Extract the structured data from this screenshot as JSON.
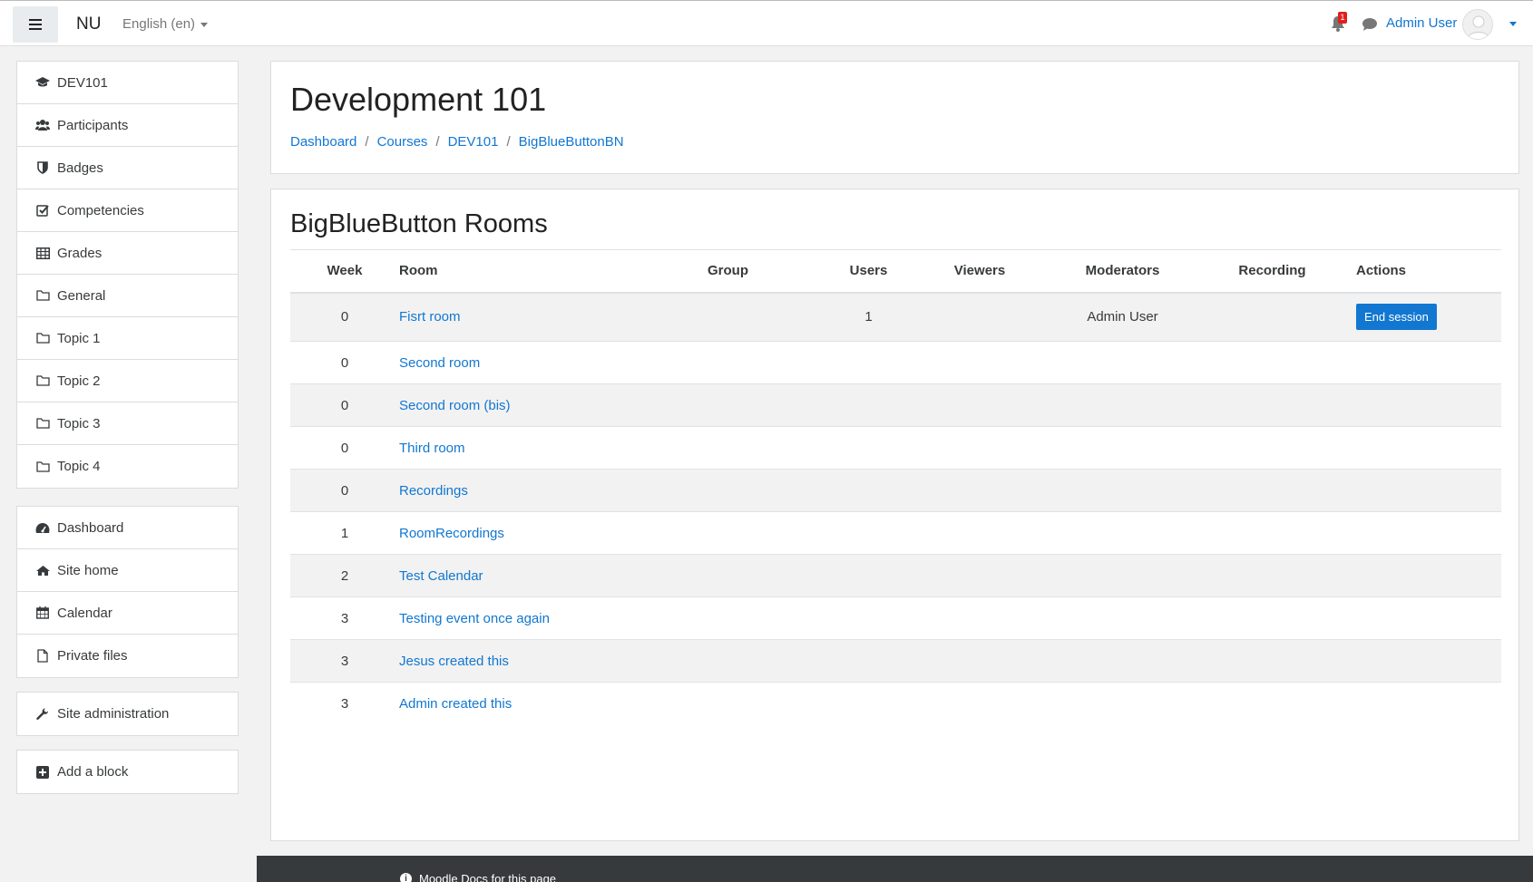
{
  "navbar": {
    "brand": "NU",
    "language": "English (en)",
    "notification_count": "1",
    "user_name": "Admin User"
  },
  "sidebar": {
    "course_items": [
      {
        "label": "DEV101",
        "icon": "graduation-cap-icon"
      },
      {
        "label": "Participants",
        "icon": "users-icon"
      },
      {
        "label": "Badges",
        "icon": "shield-icon"
      },
      {
        "label": "Competencies",
        "icon": "check-square-icon"
      },
      {
        "label": "Grades",
        "icon": "table-icon"
      },
      {
        "label": "General",
        "icon": "folder-icon"
      },
      {
        "label": "Topic 1",
        "icon": "folder-icon"
      },
      {
        "label": "Topic 2",
        "icon": "folder-icon"
      },
      {
        "label": "Topic 3",
        "icon": "folder-icon"
      },
      {
        "label": "Topic 4",
        "icon": "folder-icon"
      }
    ],
    "site_items": [
      {
        "label": "Dashboard",
        "icon": "dashboard-icon"
      },
      {
        "label": "Site home",
        "icon": "home-icon"
      },
      {
        "label": "Calendar",
        "icon": "calendar-icon"
      },
      {
        "label": "Private files",
        "icon": "file-icon"
      }
    ],
    "admin_item": {
      "label": "Site administration",
      "icon": "wrench-icon"
    },
    "add_block": {
      "label": "Add a block",
      "icon": "plus-square-icon"
    }
  },
  "header": {
    "title": "Development 101",
    "breadcrumb": [
      "Dashboard",
      "Courses",
      "DEV101",
      "BigBlueButtonBN"
    ]
  },
  "main": {
    "section_title": "BigBlueButton Rooms",
    "columns": [
      "Week",
      "Room",
      "Group",
      "Users",
      "Viewers",
      "Moderators",
      "Recording",
      "Actions"
    ],
    "rows": [
      {
        "week": "0",
        "room": "Fisrt room",
        "group": "",
        "users": "1",
        "viewers": "",
        "moderators": "Admin User",
        "recording": "",
        "action": "End session"
      },
      {
        "week": "0",
        "room": "Second room",
        "group": "",
        "users": "",
        "viewers": "",
        "moderators": "",
        "recording": "",
        "action": ""
      },
      {
        "week": "0",
        "room": "Second room (bis)",
        "group": "",
        "users": "",
        "viewers": "",
        "moderators": "",
        "recording": "",
        "action": ""
      },
      {
        "week": "0",
        "room": "Third room",
        "group": "",
        "users": "",
        "viewers": "",
        "moderators": "",
        "recording": "",
        "action": ""
      },
      {
        "week": "0",
        "room": "Recordings",
        "group": "",
        "users": "",
        "viewers": "",
        "moderators": "",
        "recording": "",
        "action": ""
      },
      {
        "week": "1",
        "room": "RoomRecordings",
        "group": "",
        "users": "",
        "viewers": "",
        "moderators": "",
        "recording": "",
        "action": ""
      },
      {
        "week": "2",
        "room": "Test Calendar",
        "group": "",
        "users": "",
        "viewers": "",
        "moderators": "",
        "recording": "",
        "action": ""
      },
      {
        "week": "3",
        "room": "Testing event once again",
        "group": "",
        "users": "",
        "viewers": "",
        "moderators": "",
        "recording": "",
        "action": ""
      },
      {
        "week": "3",
        "room": "Jesus created this",
        "group": "",
        "users": "",
        "viewers": "",
        "moderators": "",
        "recording": "",
        "action": ""
      },
      {
        "week": "3",
        "room": "Admin created this",
        "group": "",
        "users": "",
        "viewers": "",
        "moderators": "",
        "recording": "",
        "action": ""
      }
    ]
  },
  "footer": {
    "docs_link": "Moodle Docs for this page"
  },
  "colors": {
    "accent": "#1177d1",
    "badge": "#e21e1e",
    "footer_bg": "#373a3c"
  }
}
